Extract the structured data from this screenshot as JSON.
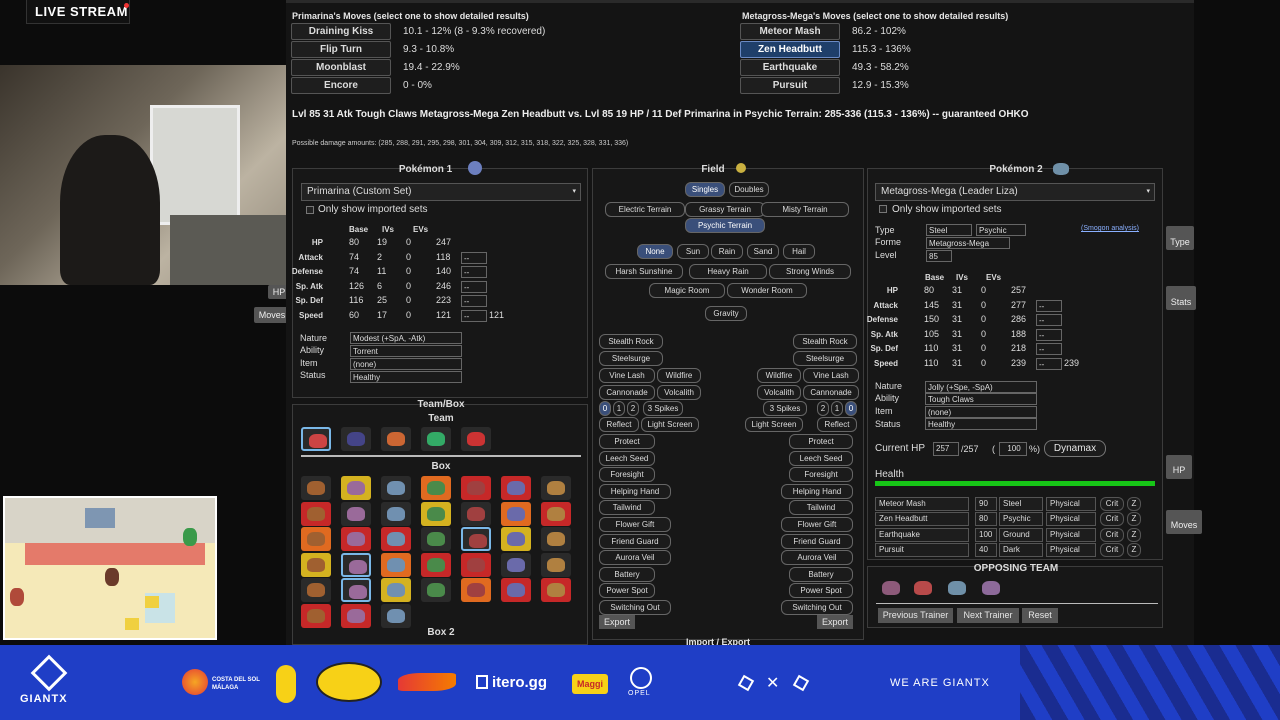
{
  "stream": {
    "live_label": "LIVE STREAM"
  },
  "moves_p1": {
    "title": "Primarina's Moves (select one to show detailed results)",
    "items": [
      {
        "name": "Draining Kiss",
        "dmg": "10.1 - 12% (8 - 9.3% recovered)"
      },
      {
        "name": "Flip Turn",
        "dmg": "9.3 - 10.8%"
      },
      {
        "name": "Moonblast",
        "dmg": "19.4 - 22.9%"
      },
      {
        "name": "Encore",
        "dmg": "0 - 0%"
      }
    ]
  },
  "moves_p2": {
    "title": "Metagross-Mega's Moves (select one to show detailed results)",
    "items": [
      {
        "name": "Meteor Mash",
        "dmg": "86.2 - 102%"
      },
      {
        "name": "Zen Headbutt",
        "dmg": "115.3 - 136%"
      },
      {
        "name": "Earthquake",
        "dmg": "49.3 - 58.2%"
      },
      {
        "name": "Pursuit",
        "dmg": "12.9 - 15.3%"
      }
    ]
  },
  "result": {
    "main": "Lvl 85 31 Atk Tough Claws Metagross-Mega Zen Headbutt vs. Lvl 85 19 HP / 11 Def Primarina in Psychic Terrain: 285-336 (115.3 - 136%) -- guaranteed OHKO",
    "possible": "Possible damage amounts: (285, 288, 291, 295, 298, 301, 304, 309, 312, 315, 318, 322, 325, 328, 331, 336)"
  },
  "p1": {
    "title": "Pokémon 1",
    "set": "Primarina (Custom Set)",
    "only_imported": "Only show imported sets",
    "headers": {
      "base": "Base",
      "ivs": "IVs",
      "evs": "EVs"
    },
    "stats": [
      {
        "label": "HP",
        "base": "80",
        "iv": "19",
        "ev": "0",
        "total": "247"
      },
      {
        "label": "Attack",
        "base": "74",
        "iv": "2",
        "ev": "0",
        "total": "118"
      },
      {
        "label": "Defense",
        "base": "74",
        "iv": "11",
        "ev": "0",
        "total": "140"
      },
      {
        "label": "Sp. Atk",
        "base": "126",
        "iv": "6",
        "ev": "0",
        "total": "246"
      },
      {
        "label": "Sp. Def",
        "base": "116",
        "iv": "25",
        "ev": "0",
        "total": "223"
      },
      {
        "label": "Speed",
        "base": "60",
        "iv": "17",
        "ev": "0",
        "total": "121"
      }
    ],
    "boost": "--",
    "speed_final": "121",
    "nature_label": "Nature",
    "nature": "Modest (+SpA, -Atk)",
    "ability_label": "Ability",
    "ability": "Torrent",
    "item_label": "Item",
    "item": "(none)",
    "status_label": "Status",
    "status": "Healthy"
  },
  "field": {
    "title": "Field",
    "formats": [
      "Singles",
      "Doubles"
    ],
    "terrains": [
      "Electric Terrain",
      "Grassy Terrain",
      "Misty Terrain",
      "Psychic Terrain"
    ],
    "weathers": [
      "None",
      "Sun",
      "Rain",
      "Sand",
      "Hail"
    ],
    "weathers2": [
      "Harsh Sunshine",
      "Heavy Rain",
      "Strong Winds"
    ],
    "rooms": [
      "Magic Room",
      "Wonder Room"
    ],
    "gravity": "Gravity",
    "left": {
      "stealth": "Stealth Rock",
      "steel": "Steelsurge",
      "vine": "Vine Lash",
      "wildfire": "Wildfire",
      "cannonade": "Cannonade",
      "volcalith": "Volcalith",
      "spikes": [
        "0",
        "1",
        "2",
        "3 Spikes"
      ],
      "reflect": "Reflect",
      "lightscreen": "Light Screen",
      "list": [
        "Protect",
        "Leech Seed",
        "Foresight",
        "Helping Hand",
        "Tailwind",
        "Flower Gift",
        "Friend Guard",
        "Aurora Veil",
        "Battery",
        "Power Spot",
        "Switching Out"
      ],
      "export": "Export"
    },
    "right": {
      "stealth": "Stealth Rock",
      "steel": "Steelsurge",
      "wildfire": "Wildfire",
      "vine": "Vine Lash",
      "volcalith": "Volcalith",
      "cannonade": "Cannonade",
      "spikes": [
        "3 Spikes",
        "2",
        "1",
        "0"
      ],
      "lightscreen": "Light Screen",
      "reflect": "Reflect",
      "list": [
        "Protect",
        "Leech Seed",
        "Foresight",
        "Helping Hand",
        "Tailwind",
        "Flower Gift",
        "Friend Guard",
        "Aurora Veil",
        "Battery",
        "Power Spot",
        "Switching Out"
      ],
      "export": "Export"
    },
    "import": "Import / Export"
  },
  "teambox": {
    "title": "Team/Box",
    "team": "Team",
    "box": "Box",
    "box2": "Box 2"
  },
  "p2": {
    "title": "Pokémon 2",
    "set": "Metagross-Mega (Leader Liza)",
    "only_imported": "Only show imported sets",
    "type_label": "Type",
    "type1": "Steel",
    "type2": "Psychic",
    "smogon": "(Smogon analysis)",
    "forme_label": "Forme",
    "forme": "Metagross-Mega",
    "level_label": "Level",
    "level": "85",
    "headers": {
      "base": "Base",
      "ivs": "IVs",
      "evs": "EVs"
    },
    "stats": [
      {
        "label": "HP",
        "base": "80",
        "iv": "31",
        "ev": "0",
        "total": "257"
      },
      {
        "label": "Attack",
        "base": "145",
        "iv": "31",
        "ev": "0",
        "total": "277"
      },
      {
        "label": "Defense",
        "base": "150",
        "iv": "31",
        "ev": "0",
        "total": "286"
      },
      {
        "label": "Sp. Atk",
        "base": "105",
        "iv": "31",
        "ev": "0",
        "total": "188"
      },
      {
        "label": "Sp. Def",
        "base": "110",
        "iv": "31",
        "ev": "0",
        "total": "218"
      },
      {
        "label": "Speed",
        "base": "110",
        "iv": "31",
        "ev": "0",
        "total": "239"
      }
    ],
    "boost": "--",
    "speed_final": "239",
    "nature_label": "Nature",
    "nature": "Jolly (+Spe, -SpA)",
    "ability_label": "Ability",
    "ability": "Tough Claws",
    "item_label": "Item",
    "item": "(none)",
    "status_label": "Status",
    "status": "Healthy",
    "current_hp_label": "Current HP",
    "current_hp": "257",
    "max_hp": "/257",
    "paren": "(",
    "pct": "100",
    "pct_sign": "%)",
    "dynamax": "Dynamax",
    "health_label": "Health",
    "health_fraction": 1.0,
    "moves": [
      {
        "name": "Meteor Mash",
        "bp": "90",
        "type": "Steel",
        "cat": "Physical",
        "crit": "Crit",
        "z": "Z"
      },
      {
        "name": "Zen Headbutt",
        "bp": "80",
        "type": "Psychic",
        "cat": "Physical",
        "crit": "Crit",
        "z": "Z"
      },
      {
        "name": "Earthquake",
        "bp": "100",
        "type": "Ground",
        "cat": "Physical",
        "crit": "Crit",
        "z": "Z"
      },
      {
        "name": "Pursuit",
        "bp": "40",
        "type": "Dark",
        "cat": "Physical",
        "crit": "Crit",
        "z": "Z"
      }
    ]
  },
  "opposing": {
    "title": "OPPOSING TEAM",
    "prev": "Previous Trainer",
    "next": "Next Trainer",
    "reset": "Reset"
  },
  "side": {
    "hp": "HP",
    "moves": "Moves",
    "type": "Type",
    "stats": "Stats",
    "hp2": "HP",
    "moves2": "Moves"
  },
  "footer": {
    "brand": "GIANTX",
    "sponsors": [
      "COSTA DEL SOL MÁLAGA",
      "itero.gg",
      "Maggi",
      "OPEL"
    ],
    "tagline": "WE ARE GIANTX"
  }
}
